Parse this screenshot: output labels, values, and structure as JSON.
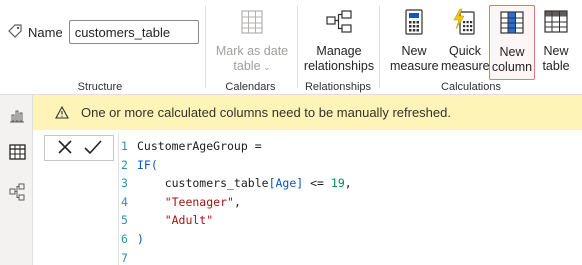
{
  "structure": {
    "name_label": "Name",
    "name_value": "customers_table",
    "group_label": "Structure"
  },
  "calendars": {
    "mark_as_date_line1": "Mark as date",
    "mark_as_date_line2": "table",
    "group_label": "Calendars"
  },
  "relationships": {
    "manage_line1": "Manage",
    "manage_line2": "relationships",
    "group_label": "Relationships"
  },
  "calculations": {
    "new_measure_line1": "New",
    "new_measure_line2": "measure",
    "quick_measure_line1": "Quick",
    "quick_measure_line2": "measure",
    "new_column_line1": "New",
    "new_column_line2": "column",
    "new_table_line1": "New",
    "new_table_line2": "table",
    "group_label": "Calculations"
  },
  "warning": {
    "message": "One or more calculated columns need to be manually refreshed."
  },
  "formula": {
    "lines": [
      {
        "n": "1",
        "tokens": [
          {
            "t": "CustomerAgeGroup =",
            "c": "tk-id"
          }
        ]
      },
      {
        "n": "2",
        "tokens": [
          {
            "t": "IF(",
            "c": "tk-kw"
          }
        ]
      },
      {
        "n": "3",
        "tokens": [
          {
            "t": "    customers_table",
            "c": "tk-tbl"
          },
          {
            "t": "[Age]",
            "c": "tk-col"
          },
          {
            "t": " <= ",
            "c": "tk-op"
          },
          {
            "t": "19",
            "c": "tk-num"
          },
          {
            "t": ",",
            "c": "tk-op"
          }
        ]
      },
      {
        "n": "4",
        "tokens": [
          {
            "t": "    \"Teenager\"",
            "c": "tk-str"
          },
          {
            "t": ",",
            "c": "tk-op"
          }
        ]
      },
      {
        "n": "5",
        "tokens": [
          {
            "t": "    \"Adult\"",
            "c": "tk-str"
          }
        ]
      },
      {
        "n": "6",
        "tokens": [
          {
            "t": ")",
            "c": "tk-kw"
          }
        ]
      },
      {
        "n": "7",
        "tokens": []
      }
    ]
  },
  "colors": {
    "warning_bg": "#fff4b8",
    "selected_border": "#e07a7a",
    "accent_blue": "#0b57c7",
    "line_number": "#2b91af"
  }
}
